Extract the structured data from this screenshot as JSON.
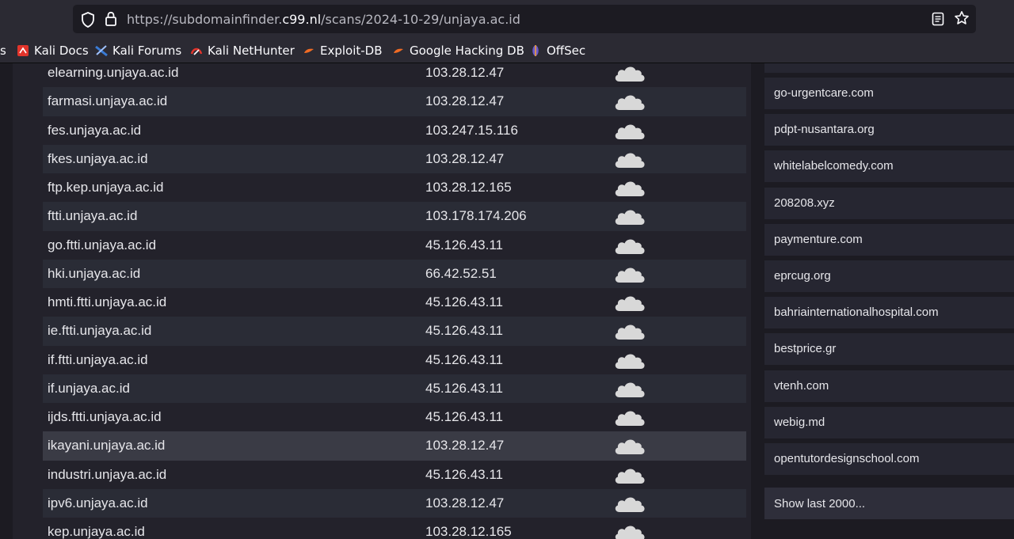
{
  "browser": {
    "url_prefix": "https://subdomainfinder.",
    "url_host": "c99.nl",
    "url_suffix": "/scans/2024-10-29/unjaya.ac.id"
  },
  "bookmarks": [
    {
      "label": "s"
    },
    {
      "label": "Kali Docs",
      "icon": "kali-docs-icon",
      "color": "#e2342b"
    },
    {
      "label": "Kali Forums",
      "icon": "kali-forums-icon",
      "color": "#3a7bd5"
    },
    {
      "label": "Kali NetHunter",
      "icon": "kali-nethunter-icon",
      "color": "#e2342b"
    },
    {
      "label": "Exploit-DB",
      "icon": "exploit-db-icon",
      "color": "#f06b24"
    },
    {
      "label": "Google Hacking DB",
      "icon": "ghdb-icon",
      "color": "#f06b24"
    },
    {
      "label": "OffSec",
      "icon": "offsec-icon",
      "color": "#6a5acd"
    }
  ],
  "subdomains": [
    {
      "name": "elearning.unjaya.ac.id",
      "ip": "103.28.12.47"
    },
    {
      "name": "farmasi.unjaya.ac.id",
      "ip": "103.28.12.47"
    },
    {
      "name": "fes.unjaya.ac.id",
      "ip": "103.247.15.116"
    },
    {
      "name": "fkes.unjaya.ac.id",
      "ip": "103.28.12.47"
    },
    {
      "name": "ftp.kep.unjaya.ac.id",
      "ip": "103.28.12.165"
    },
    {
      "name": "ftti.unjaya.ac.id",
      "ip": "103.178.174.206"
    },
    {
      "name": "go.ftti.unjaya.ac.id",
      "ip": "45.126.43.11"
    },
    {
      "name": "hki.unjaya.ac.id",
      "ip": "66.42.52.51"
    },
    {
      "name": "hmti.ftti.unjaya.ac.id",
      "ip": "45.126.43.11"
    },
    {
      "name": "ie.ftti.unjaya.ac.id",
      "ip": "45.126.43.11"
    },
    {
      "name": "if.ftti.unjaya.ac.id",
      "ip": "45.126.43.11"
    },
    {
      "name": "if.unjaya.ac.id",
      "ip": "45.126.43.11"
    },
    {
      "name": "ijds.ftti.unjaya.ac.id",
      "ip": "45.126.43.11"
    },
    {
      "name": "ikayani.unjaya.ac.id",
      "ip": "103.28.12.47"
    },
    {
      "name": "industri.unjaya.ac.id",
      "ip": "45.126.43.11"
    },
    {
      "name": "ipv6.unjaya.ac.id",
      "ip": "103.28.12.47"
    },
    {
      "name": "kep.unjaya.ac.id",
      "ip": "103.28.12.165"
    }
  ],
  "highlighted_row": "ikayani.unjaya.ac.id",
  "recent_scans": [
    "go-urgentcare.com",
    "pdpt-nusantara.org",
    "whitelabelcomedy.com",
    "208208.xyz",
    "paymenture.com",
    "eprcug.org",
    "bahriainternationalhospital.com",
    "bestprice.gr",
    "vtenh.com",
    "webig.md",
    "opentutordesignschool.com"
  ],
  "show_more_label": "Show last 2000...",
  "colors": {
    "cloud": "#d8d8d8",
    "row_odd": "#2a2c36",
    "row_highlight": "#3a3b45"
  }
}
